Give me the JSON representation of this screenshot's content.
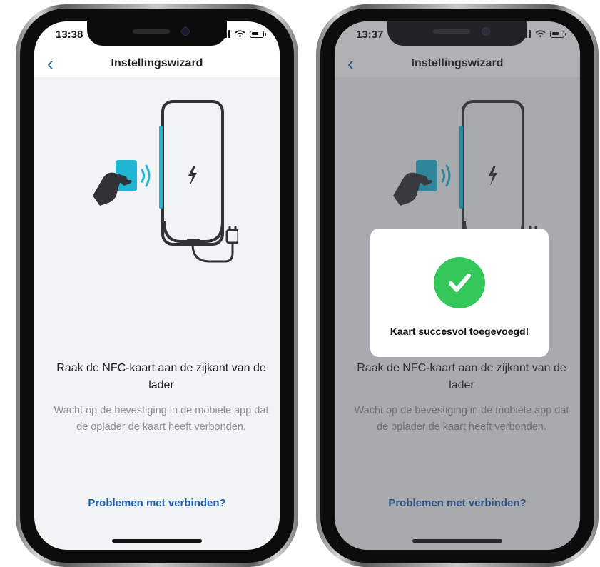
{
  "colors": {
    "accent_blue": "#1b5fb0",
    "nfc_cyan": "#1fb6d3",
    "success_green": "#34c759",
    "screen_bg": "#f2f3f5"
  },
  "screens": [
    {
      "status_time": "13:38",
      "nav_title": "Instellingswizard",
      "heading": "Raak de NFC-kaart aan de zijkant van de lader",
      "subtext": "Wacht op de bevestiging in de mobiele app dat de oplader de kaart heeft verbonden.",
      "help_link": "Problemen met verbinden?"
    },
    {
      "status_time": "13:37",
      "nav_title": "Instellingswizard",
      "heading": "Raak de NFC-kaart aan de zijkant van de lader",
      "subtext": "Wacht op de bevestiging in de mobiele app dat de oplader de kaart heeft verbonden.",
      "help_link": "Problemen met verbinden?",
      "modal": {
        "message": "Kaart succesvol toegevoegd!",
        "icon": "checkmark-circle-icon"
      }
    }
  ],
  "icons": {
    "back": "chevron-left-icon",
    "signal": "cellular-signal-icon",
    "wifi": "wifi-icon",
    "battery": "battery-icon",
    "bolt": "lightning-bolt-icon",
    "hand": "hand-holding-card-icon",
    "nfc": "nfc-waves-icon",
    "plug": "power-plug-icon"
  }
}
